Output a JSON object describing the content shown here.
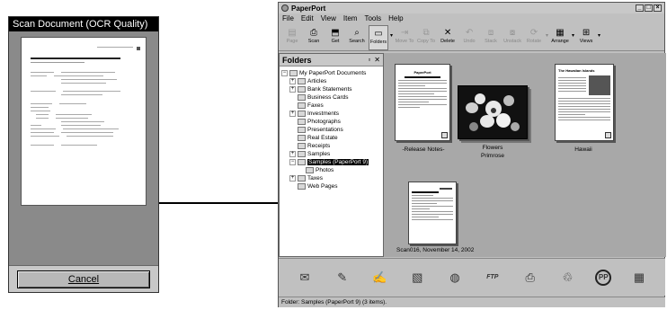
{
  "scan_window": {
    "title": "Scan Document (OCR Quality)",
    "cancel_label": "Cancel"
  },
  "paperport": {
    "title": "PaperPort",
    "menu": [
      "File",
      "Edit",
      "View",
      "Item",
      "Tools",
      "Help"
    ],
    "toolbar": [
      {
        "label": "Page",
        "icon": "page-icon",
        "enabled": false
      },
      {
        "label": "Scan",
        "icon": "scan-icon",
        "enabled": true
      },
      {
        "label": "Get",
        "icon": "get-icon",
        "enabled": true
      },
      {
        "label": "Search",
        "icon": "search-icon",
        "enabled": true
      },
      {
        "label": "Folders",
        "icon": "folders-icon",
        "enabled": true
      },
      {
        "label": "Move To",
        "icon": "move-to-icon",
        "enabled": false
      },
      {
        "label": "Copy To",
        "icon": "copy-to-icon",
        "enabled": false
      },
      {
        "label": "Delete",
        "icon": "delete-icon",
        "enabled": true
      },
      {
        "label": "Undo",
        "icon": "undo-icon",
        "enabled": false
      },
      {
        "label": "Stack",
        "icon": "stack-icon",
        "enabled": false
      },
      {
        "label": "Unstack",
        "icon": "unstack-icon",
        "enabled": false
      },
      {
        "label": "Rotate",
        "icon": "rotate-icon",
        "enabled": false
      },
      {
        "label": "Arrange",
        "icon": "arrange-icon",
        "enabled": true
      },
      {
        "label": "Views",
        "icon": "views-icon",
        "enabled": true
      }
    ],
    "folders": {
      "header": "Folders",
      "root": "My PaperPort Documents",
      "items": [
        {
          "label": "Articles",
          "expandable": true
        },
        {
          "label": "Bank Statements",
          "expandable": true
        },
        {
          "label": "Business Cards",
          "expandable": false
        },
        {
          "label": "Faxes",
          "expandable": false
        },
        {
          "label": "Investments",
          "expandable": true
        },
        {
          "label": "Photographs",
          "expandable": false
        },
        {
          "label": "Presentations",
          "expandable": false
        },
        {
          "label": "Real Estate",
          "expandable": false
        },
        {
          "label": "Receipts",
          "expandable": false
        },
        {
          "label": "Samples",
          "expandable": true
        },
        {
          "label": "Samples (PaperPort 9)",
          "expandable": true,
          "selected": true
        },
        {
          "label": "Photos",
          "child": true
        },
        {
          "label": "Taxes",
          "expandable": true
        },
        {
          "label": "Web Pages",
          "expandable": false
        }
      ]
    },
    "items": {
      "release_notes": "-Release Notes-",
      "release_notes_heading": "PaperPort",
      "flowers": "Flowers",
      "flowers_sub": "Primrose",
      "hawaii": "Hawaii",
      "hawaii_heading": "The Hawaiian Islands",
      "scan016": "Scan016, November 14, 2002"
    },
    "bottom_bar": [
      "mail-icon",
      "paint-icon",
      "note-icon",
      "document-icon",
      "globe-icon",
      "ftp-icon",
      "printer-icon",
      "recycle-icon",
      "pp-icon",
      "calculator-icon"
    ],
    "bottom_bar_labels": {
      "ftp": "FTP",
      "pp": "PP"
    },
    "status": "Folder: Samples (PaperPort 9) (3 items)."
  }
}
